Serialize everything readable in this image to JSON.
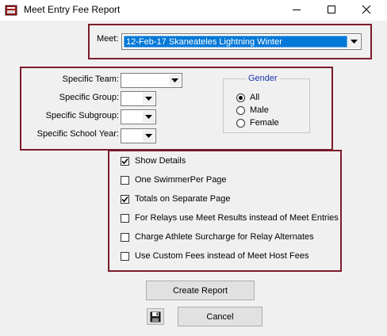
{
  "window": {
    "title": "Meet Entry Fee Report",
    "icon": "app-icon",
    "controls": {
      "minimize": "minimize-icon",
      "maximize": "maximize-icon",
      "close": "close-icon"
    }
  },
  "meet": {
    "label": "Meet:",
    "selected": "12-Feb-17 Skaneateles Lightning Winter"
  },
  "filters": {
    "team_label": "Specific Team:",
    "group_label": "Specific Group:",
    "subgroup_label": "Specific Subgroup:",
    "school_year_label": "Specific  School Year:",
    "team_value": "",
    "group_value": "",
    "subgroup_value": "",
    "school_year_value": ""
  },
  "gender": {
    "title": "Gender",
    "options": [
      {
        "label": "All",
        "selected": true
      },
      {
        "label": "Male",
        "selected": false
      },
      {
        "label": "Female",
        "selected": false
      }
    ]
  },
  "options": [
    {
      "label": "Show Details",
      "checked": true
    },
    {
      "label": "One SwimmerPer Page",
      "checked": false
    },
    {
      "label": "Totals on Separate Page",
      "checked": true
    },
    {
      "label": "For Relays use Meet Results instead of Meet Entries",
      "checked": false
    },
    {
      "label": "Charge Athlete Surcharge for Relay Alternates",
      "checked": false
    },
    {
      "label": "Use Custom Fees instead of Meet Host Fees",
      "checked": false
    }
  ],
  "buttons": {
    "create_report": "Create Report",
    "cancel": "Cancel",
    "save_icon": "floppy-disk-icon"
  },
  "colors": {
    "frame_border": "#7b1c2a",
    "selection": "#0078d7",
    "gender_title": "#1a33b0",
    "window_bg": "#f0f0f0"
  }
}
